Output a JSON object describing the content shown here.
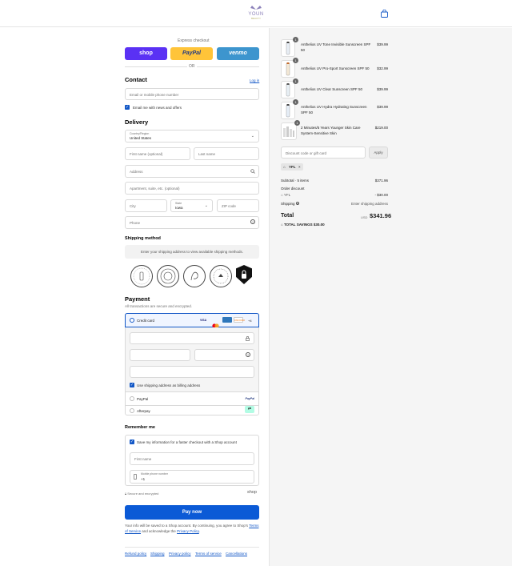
{
  "header": {
    "logo_text": "YOUN",
    "logo_sub": "BEAUTY",
    "cart_icon": "bag-icon"
  },
  "express": {
    "title": "Express checkout",
    "shop_label": "shop",
    "paypal_label": "PayPal",
    "venmo_label": "venmo",
    "or_label": "OR",
    "colors": {
      "shop": "#5a31f4",
      "paypal": "#ffc439",
      "venmo": "#3d95ce"
    }
  },
  "contact": {
    "title": "Contact",
    "login_label": "Log in",
    "email_placeholder": "Email or mobile phone number",
    "news_label": "Email me with news and offers"
  },
  "delivery": {
    "title": "Delivery",
    "country_label": "Country/Region",
    "country_value": "United States",
    "first_name_placeholder": "First name (optional)",
    "last_name_placeholder": "Last name",
    "address_placeholder": "Address",
    "apartment_placeholder": "Apartment, suite, etc. (optional)",
    "city_placeholder": "City",
    "state_label": "State",
    "state_value": "Iowa",
    "zip_placeholder": "ZIP code",
    "phone_placeholder": "Phone"
  },
  "shipping": {
    "title": "Shipping method",
    "message": "Enter your shipping address to view available shipping methods."
  },
  "payment": {
    "title": "Payment",
    "subtitle": "All transactions are secure and encrypted.",
    "credit_card_label": "Credit card",
    "card_brands": [
      "VISA",
      "MC",
      "AMEX",
      "DISCOVER",
      "+4"
    ],
    "billing_label": "Use shipping address as billing address",
    "paypal_label": "PayPal",
    "afterpay_label": "Afterpay"
  },
  "remember": {
    "title": "Remember me",
    "save_label": "Save my information for a faster checkout with a Shop account",
    "first_name_placeholder": "First name",
    "phone_label": "Mobile phone number",
    "phone_value": "+1",
    "secure_label": "Secure and encrypted",
    "shop_label": "shop"
  },
  "pay_now": {
    "label": "Pay now",
    "color": "#0b5ad6"
  },
  "terms": {
    "line1": "Your info will be saved to a Shop account. By continuing, you agree to Shop's",
    "terms_link": "Terms of Service",
    "mid": "and acknowledge the",
    "privacy_link": "Privacy Policy",
    "end": "."
  },
  "footer_links": [
    "Refund policy",
    "Shipping",
    "Privacy policy",
    "Terms of service",
    "Cancellations"
  ],
  "cart": {
    "items": [
      {
        "qty": "1",
        "name": "Anthelios UV Tone Invisible Sunscreen SPF 50",
        "price": "$39.99"
      },
      {
        "qty": "1",
        "name": "Anthelios UV Pro-Sport Sunscreen SPF 50",
        "price": "$32.99"
      },
      {
        "qty": "1",
        "name": "Anthelios UV Clear Sunscreen SPF 50",
        "price": "$39.99"
      },
      {
        "qty": "1",
        "name": "Anthelios UV Hydra Hydrating Sunscreen SPF 50",
        "price": "$39.99"
      },
      {
        "qty": "1",
        "name": "2 Minutes/5 Years Younger Skin Care System-Sensitive Skin",
        "price": "$219.00"
      }
    ],
    "discount_placeholder": "Discount code or gift card",
    "apply_label": "Apply",
    "code_tag": "YFL",
    "subtotal_label": "Subtotal · 5 items",
    "subtotal_value": "$371.96",
    "order_discount_label": "Order discount",
    "discount_code": "YFL",
    "discount_value": "- $30.00",
    "shipping_label": "Shipping",
    "shipping_value": "Enter shipping address",
    "total_label": "Total",
    "currency": "USD",
    "total_value": "$341.96",
    "savings_label": "TOTAL SAVINGS",
    "savings_value": "$30.00"
  }
}
